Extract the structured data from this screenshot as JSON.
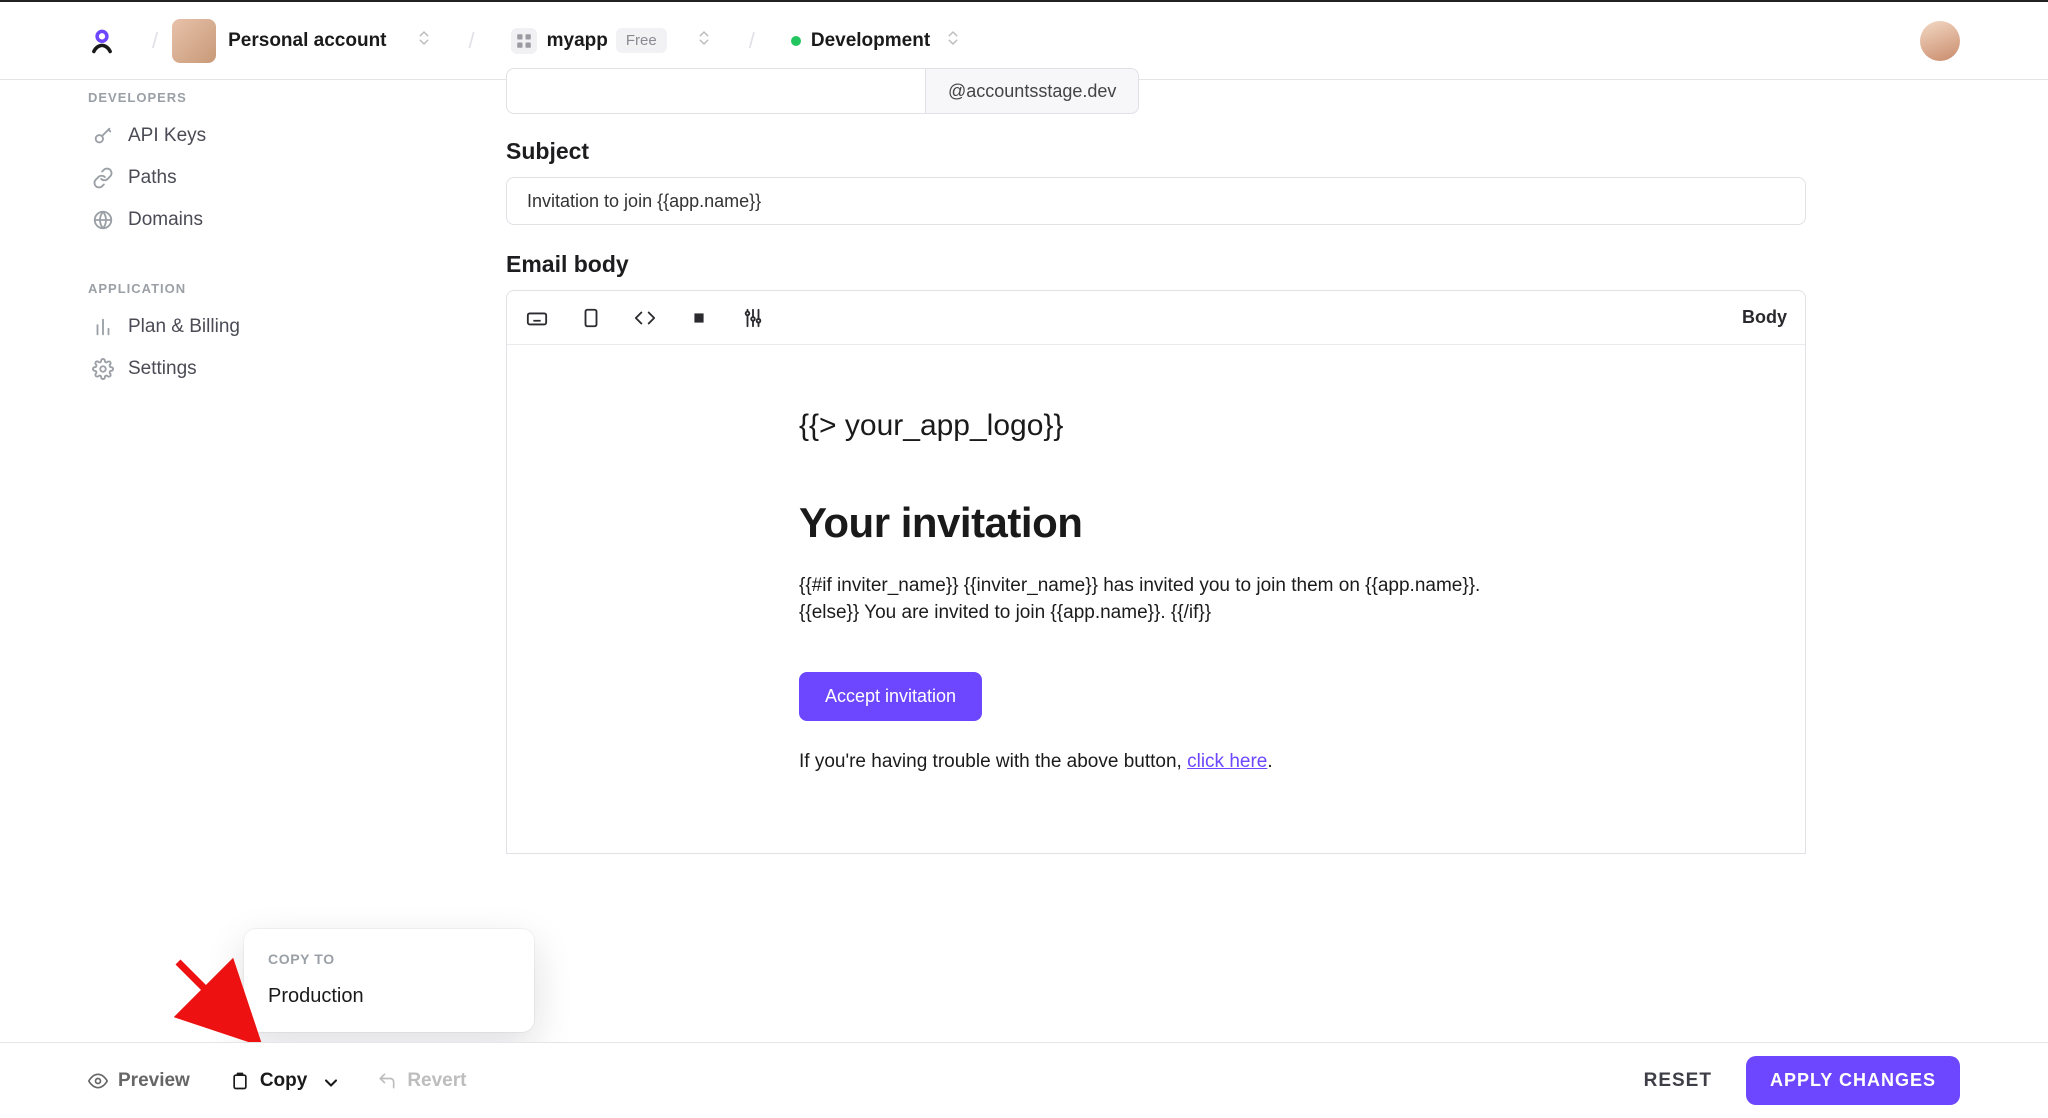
{
  "nav": {
    "account_label": "Personal account",
    "app_name": "myapp",
    "plan_badge": "Free",
    "env_label": "Development"
  },
  "sidebar": {
    "sections": {
      "developers": {
        "title": "DEVELOPERS",
        "items": [
          "API Keys",
          "Paths",
          "Domains"
        ]
      },
      "application": {
        "title": "APPLICATION",
        "items": [
          "Plan & Billing",
          "Settings"
        ]
      }
    }
  },
  "form": {
    "from_domain": "@accountsstage.dev",
    "subject_label": "Subject",
    "subject_value": "Invitation to join {{app.name}}",
    "body_label": "Email body",
    "toolbar_mode": "Body"
  },
  "email": {
    "logo_token": "{{> your_app_logo}}",
    "heading": "Your invitation",
    "paragraph": "{{#if inviter_name}} {{inviter_name}} has invited you to join them on {{app.name}}. {{else}} You are invited to join {{app.name}}. {{/if}}",
    "button_label": "Accept invitation",
    "trouble_prefix": "If you're having trouble with the above button, ",
    "trouble_link": "click here",
    "trouble_suffix": "."
  },
  "copy_popover": {
    "title": "COPY TO",
    "item": "Production"
  },
  "footer": {
    "preview": "Preview",
    "copy": "Copy",
    "revert": "Revert",
    "reset": "RESET",
    "apply": "APPLY CHANGES"
  }
}
